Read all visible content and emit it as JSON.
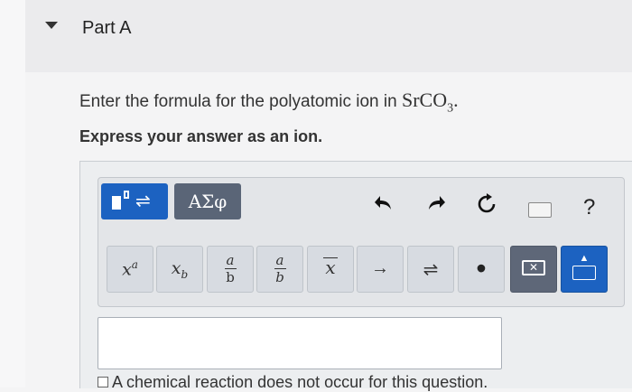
{
  "part": {
    "title": "Part A"
  },
  "question": {
    "text": "Enter the formula for the polyatomic ion in ",
    "formula_main": "SrCO",
    "formula_sub": "3",
    "formula_end": ".",
    "instruction": "Express your answer as an ion."
  },
  "toolbar": {
    "templates_icon": "templates-arrows-icon",
    "greek_label": "ΑΣφ",
    "undo_icon": "undo-icon",
    "redo_icon": "redo-icon",
    "reset_icon": "reset-icon",
    "keyboard_icon": "keyboard-icon",
    "help_label": "?"
  },
  "keys": {
    "superscript_base": "x",
    "superscript_exp": "a",
    "subscript_base": "x",
    "subscript_sub": "b",
    "frac_num": "a",
    "frac_den": "b",
    "frac2_num": "a",
    "frac2_den": "b",
    "bar_label": "x",
    "arrow_label": "→",
    "equilibrium_label": "⇌",
    "dot_label": "•",
    "delete_icon": "backspace-icon",
    "keyboard_toggle_icon": "keyboard-toggle-icon"
  },
  "answer": {
    "value": ""
  },
  "no_reaction": {
    "label": "A chemical reaction does not occur for this question.",
    "checked": false
  },
  "colors": {
    "primary": "#1c62c1",
    "secondary": "#5a6577"
  }
}
